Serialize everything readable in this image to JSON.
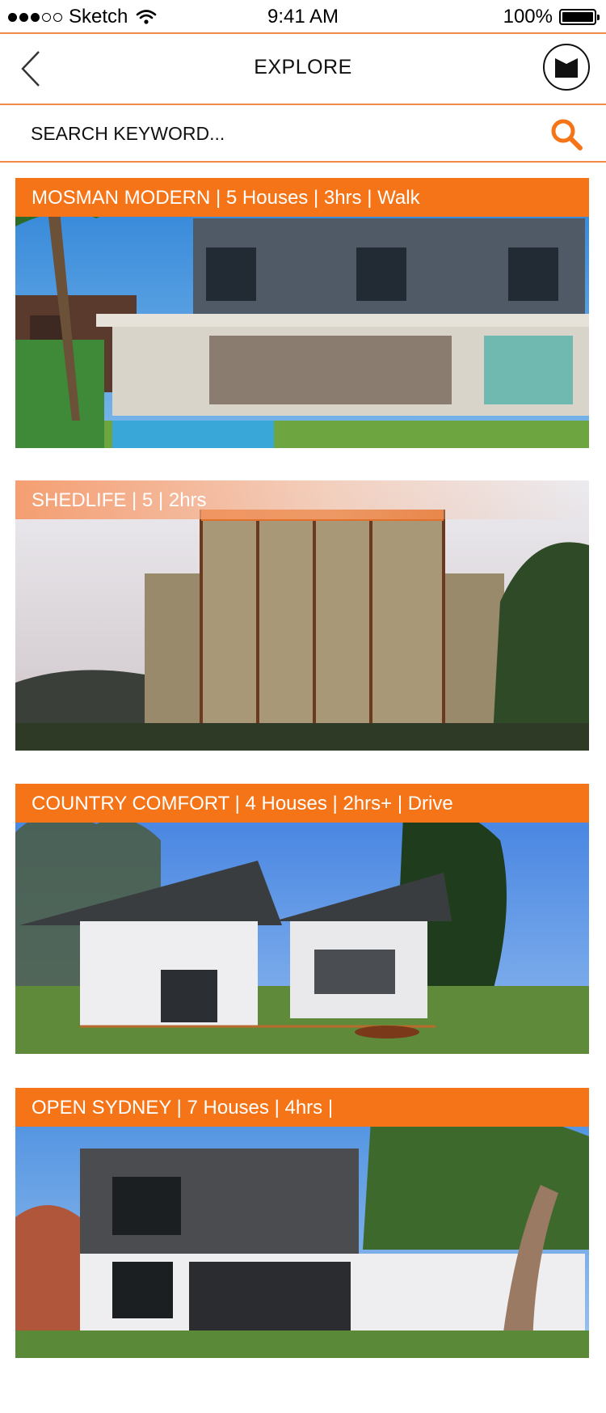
{
  "status_bar": {
    "carrier": "Sketch",
    "time": "9:41 AM",
    "battery": "100%",
    "battery_level": 1.0,
    "signal_icon": "signal-dots-icon",
    "wifi_icon": "wifi-icon"
  },
  "nav": {
    "title": "EXPLORE",
    "back_icon": "chevron-left-icon",
    "brand_icon": "logo-icon"
  },
  "search": {
    "placeholder": "SEARCH KEYWORD...",
    "icon": "search-icon"
  },
  "colors": {
    "accent": "#f57417",
    "divider": "#f08a4b"
  },
  "tours": [
    {
      "label": "MOSMAN MODERN | 5 Houses | 3hrs | Walk"
    },
    {
      "label": "SHEDLIFE | 5 | 2hrs"
    },
    {
      "label": "COUNTRY COMFORT | 4 Houses | 2hrs+ | Drive"
    },
    {
      "label": "OPEN SYDNEY | 7 Houses | 4hrs |"
    }
  ]
}
